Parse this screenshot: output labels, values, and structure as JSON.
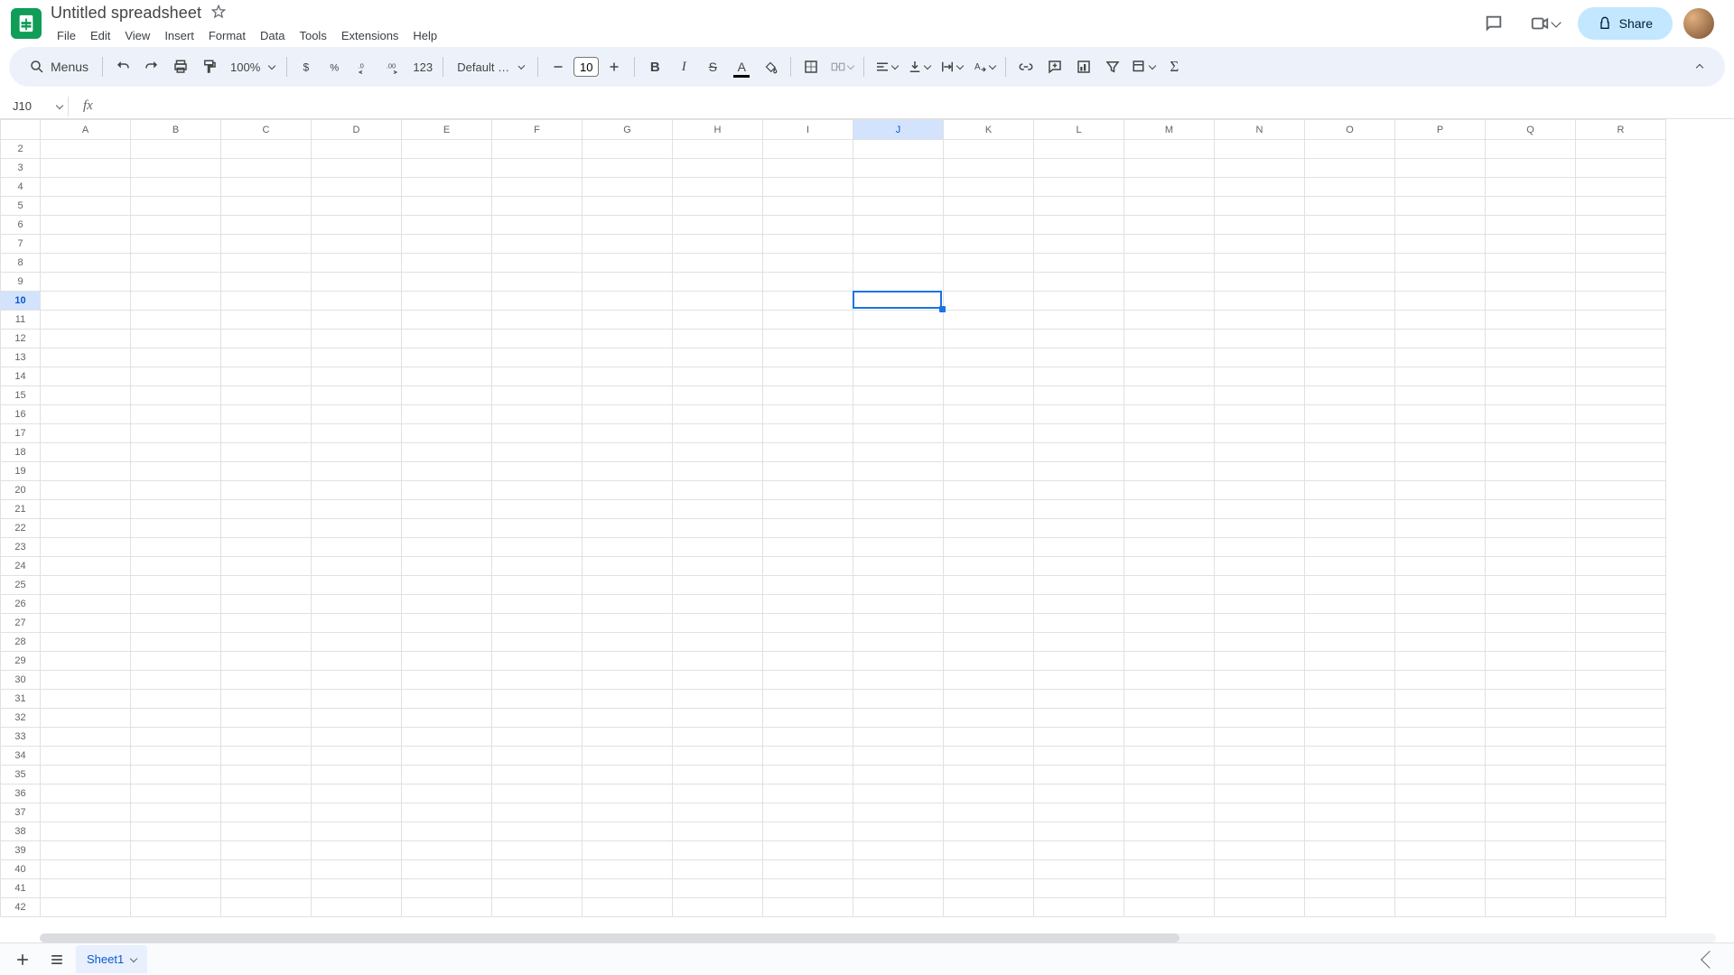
{
  "document": {
    "title": "Untitled spreadsheet"
  },
  "menubar": [
    "File",
    "Edit",
    "View",
    "Insert",
    "Format",
    "Data",
    "Tools",
    "Extensions",
    "Help"
  ],
  "header": {
    "share_label": "Share"
  },
  "toolbar": {
    "search_label": "Menus",
    "zoom": "100%",
    "font_family": "Default (Arial)",
    "font_size": "10",
    "number_123": "123"
  },
  "name_box": {
    "value": "J10"
  },
  "grid": {
    "columns": [
      "A",
      "B",
      "C",
      "D",
      "E",
      "F",
      "G",
      "H",
      "I",
      "J",
      "K",
      "L",
      "M",
      "N",
      "O",
      "P",
      "Q",
      "R"
    ],
    "row_start": 2,
    "row_end": 42,
    "selected_cell": "J10",
    "selected_col_index": 9,
    "selected_row_number": 10
  },
  "sheets": {
    "active_tab": "Sheet1"
  }
}
